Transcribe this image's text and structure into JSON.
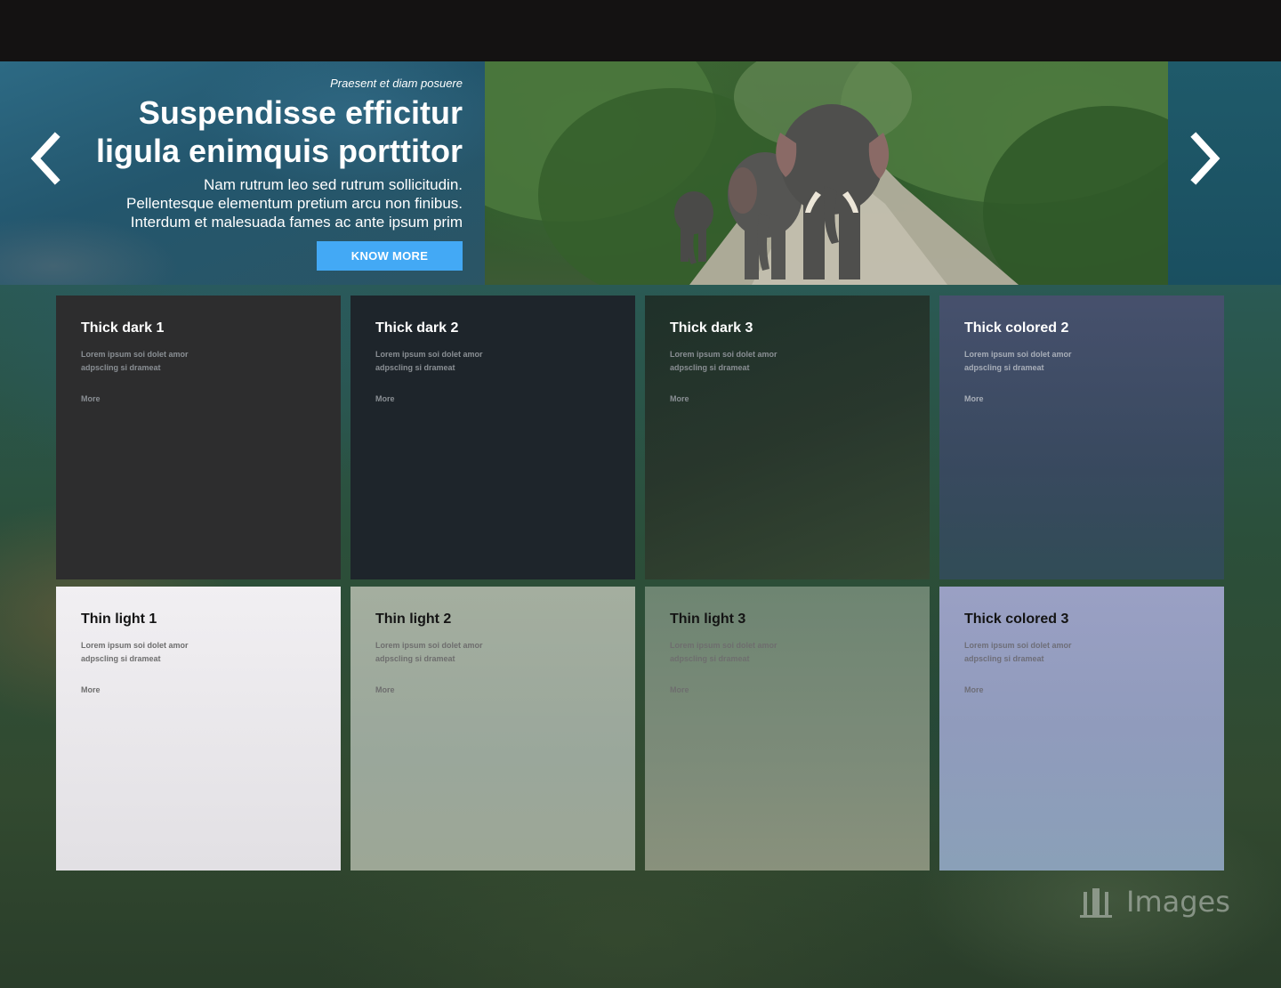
{
  "hero": {
    "kicker": "Praesent et diam posuere",
    "headline_line1": "Suspendisse efficitur",
    "headline_line2": "ligula enimquis porttitor",
    "body_line1": "Nam  rutrum leo sed rutrum sollicitudin.",
    "body_line2": "Pellentesque elementum pretium arcu non finibus.",
    "body_line3": "Interdum et malesuada fames ac ante ipsum prim",
    "cta_label": "KNOW MORE",
    "prev_icon": "chevron-left-icon",
    "next_icon": "chevron-right-icon",
    "photo_subject": "elephants walking on forest road"
  },
  "cards": [
    {
      "title": "Thick dark 1",
      "desc": "Lorem ipsum soi dolet amor adpscling si drameat",
      "more": "More"
    },
    {
      "title": "Thick dark 2",
      "desc": "Lorem ipsum soi dolet amor adpscling si drameat",
      "more": "More"
    },
    {
      "title": "Thick dark 3",
      "desc": "Lorem ipsum soi dolet amor adpscling si drameat",
      "more": "More"
    },
    {
      "title": "Thick colored 2",
      "desc": "Lorem ipsum soi dolet amor adpscling si drameat",
      "more": "More"
    },
    {
      "title": "Thin light 1",
      "desc": "Lorem ipsum soi dolet amor adpscling si drameat",
      "more": "More"
    },
    {
      "title": "Thin light 2",
      "desc": "Lorem ipsum soi dolet amor adpscling si drameat",
      "more": "More"
    },
    {
      "title": "Thin light 3",
      "desc": "Lorem ipsum soi dolet amor adpscling si drameat",
      "more": "More"
    },
    {
      "title": "Thick colored 3",
      "desc": "Lorem ipsum soi dolet amor adpscling si drameat",
      "more": "More"
    }
  ],
  "watermark": {
    "text": "Images"
  },
  "colors": {
    "topbar": "#141212",
    "cta": "#43a9f5",
    "card_dark_1": "#2d2d2e",
    "card_dark_2": "#1e252b",
    "card_light_1": "#f1eff2"
  }
}
